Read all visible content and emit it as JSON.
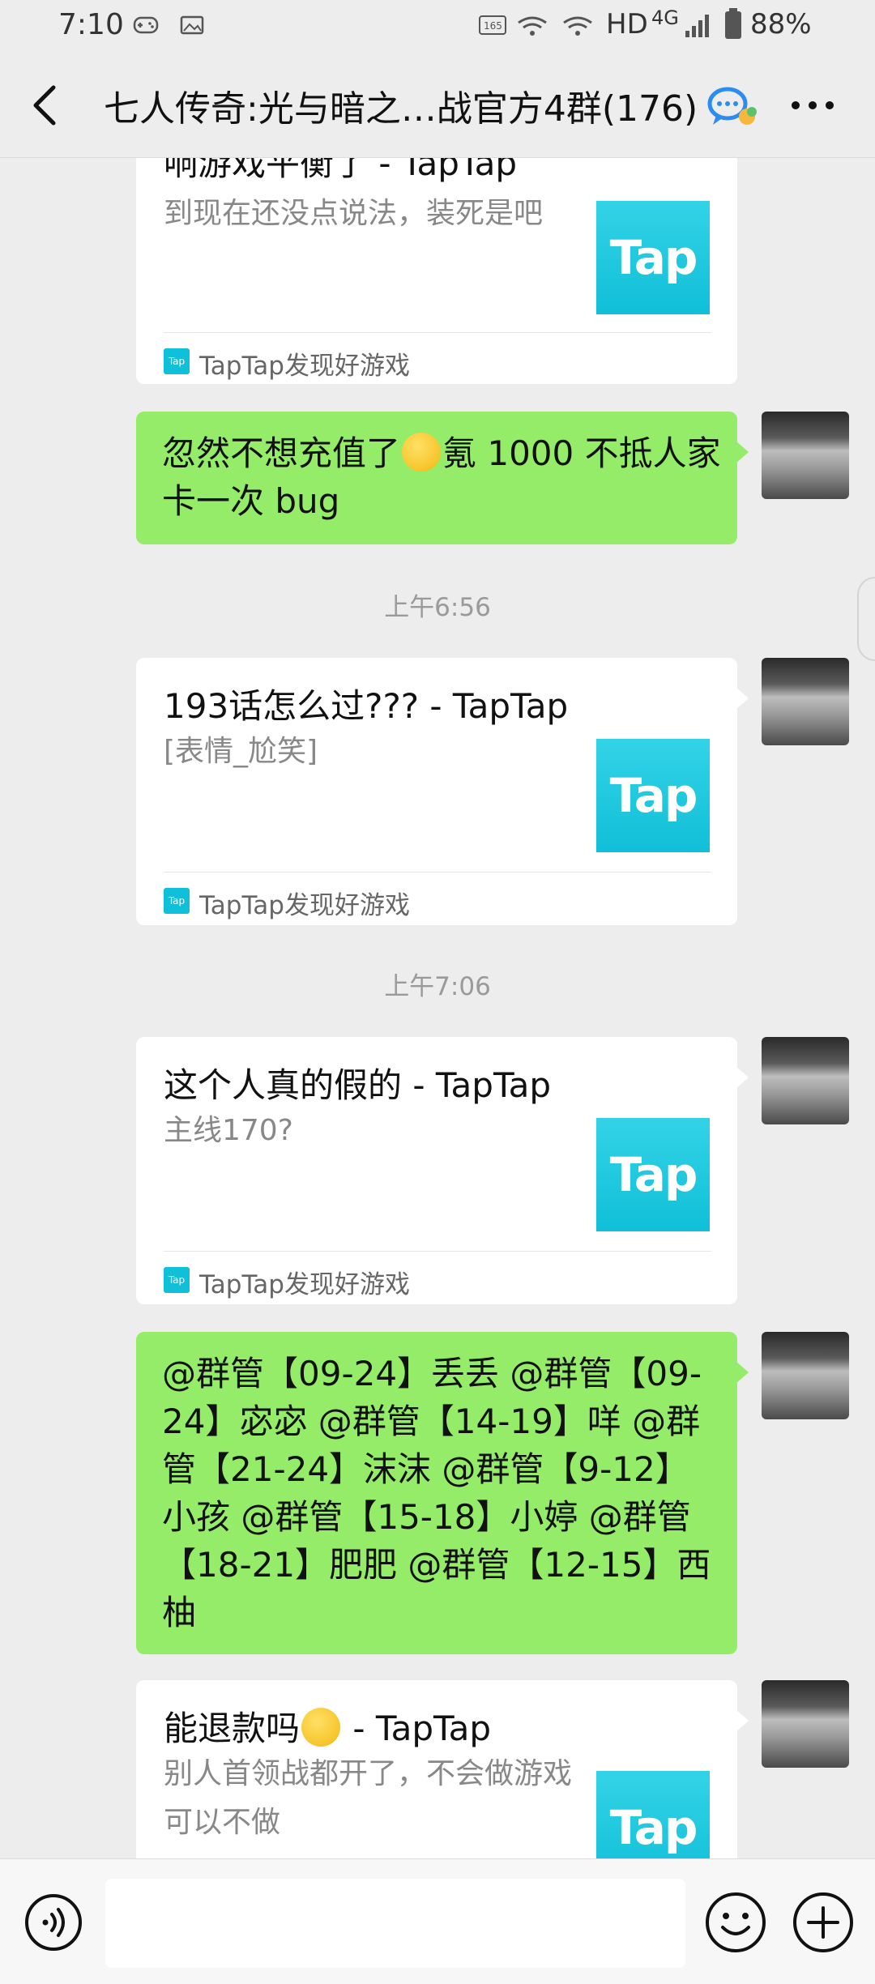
{
  "status_bar": {
    "time": "7:10",
    "network": "HD",
    "signal": "4G",
    "battery": "88%"
  },
  "header": {
    "title": "七人传奇:光与暗之…战官方4群(176)"
  },
  "chat": {
    "top_card": {
      "title": "响游戏平衡了 - TapTap",
      "desc": "到现在还没点说法，装死是吧",
      "logo": "Tap",
      "source": "TapTap发现好游戏"
    },
    "msg1": {
      "text_before": "忽然不想充值了",
      "emoji": "thinking-face",
      "text_after": "氪 1000 不抵人家卡一次 bug"
    },
    "time1": "上午6:56",
    "card2": {
      "title": "193话怎么过???   - TapTap",
      "desc": "[表情_尬笑]",
      "logo": "Tap",
      "source": "TapTap发现好游戏"
    },
    "time2": "上午7:06",
    "card3": {
      "title": "这个人真的假的 - TapTap",
      "desc": "主线170?",
      "logo": "Tap",
      "source": "TapTap发现好游戏"
    },
    "msg2": {
      "text": "@群管【09-24】丢丢 @群管【09-24】宓宓 @群管【14-19】咩 @群管【21-24】沫沫 @群管【9-12】小孩 @群管【15-18】小婷 @群管【18-21】肥肥 @群管【12-15】西柚"
    },
    "card4": {
      "title_before": "能退款吗",
      "emoji": "grinning-sweat",
      "title_after": " - TapTap",
      "desc": "别人首领战都开了，不会做游戏可以不做",
      "logo": "Tap"
    }
  },
  "input_bar": {
    "placeholder": ""
  },
  "colors": {
    "bubble_green": "#95EC69",
    "card_white": "#FFFFFF",
    "background": "#EDEDED",
    "tap_cyan": "#10BFD8"
  }
}
